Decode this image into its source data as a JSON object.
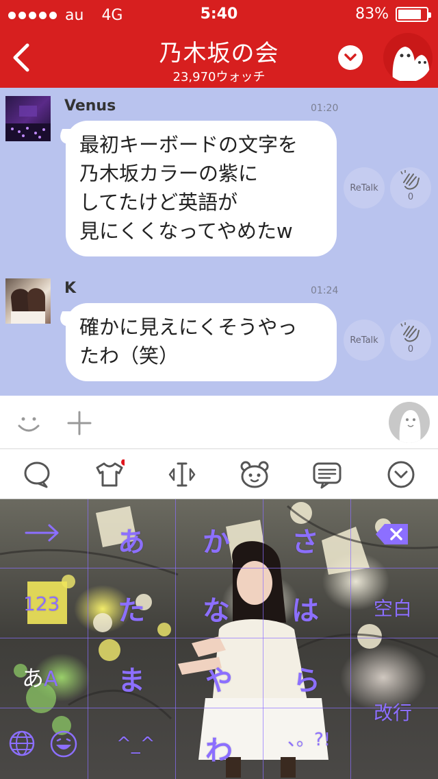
{
  "status": {
    "carrier": "au",
    "network": "4G",
    "time": "5:40",
    "battery": "83%",
    "battery_level": 0.83
  },
  "nav": {
    "title": "乃木坂の会",
    "subtitle": "23,970ウォッチ"
  },
  "messages": [
    {
      "name": "Venus",
      "time": "01:20",
      "lines": [
        "最初キーボードの文字を",
        "乃木坂カラーの紫に",
        "してたけど英語が",
        "見にくくなってやめたw"
      ],
      "retalk": "ReTalk",
      "claps": "0"
    },
    {
      "name": "K",
      "time": "01:24",
      "lines": [
        "確かに見えにくそうやっ",
        "たわ（笑）"
      ],
      "retalk": "ReTalk",
      "claps": "0"
    }
  ],
  "keyboard": {
    "keys": {
      "a": "あ",
      "ka": "か",
      "sa": "さ",
      "num": "123",
      "ta": "た",
      "na": "な",
      "ha": "は",
      "space": "空白",
      "kana": "あ",
      "abc": "A",
      "ma": "ま",
      "ya": "や",
      "ra": "ら",
      "enter": "改行",
      "emoticon": "^_^",
      "wa": "わ",
      "punct": "、。?!"
    }
  },
  "colors": {
    "header": "#d71f1f",
    "chat_bg": "#b9c3ee",
    "key_purple": "#8c6fff"
  },
  "icons": [
    "back-icon",
    "chevron-down-icon",
    "mascot-icon",
    "smile-icon",
    "plus-icon",
    "profile-icon",
    "chat-bubble-icon",
    "shirt-icon",
    "cursor-icon",
    "bear-face-icon",
    "message-icon",
    "chevron-circle-icon",
    "arrow-right-icon",
    "delete-icon",
    "globe-icon",
    "emoji-icon",
    "clap-icon"
  ]
}
